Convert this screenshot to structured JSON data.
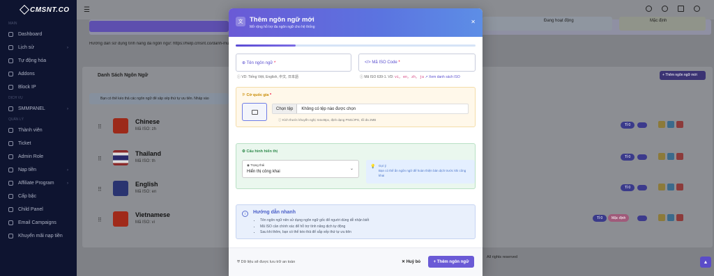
{
  "brand": {
    "logo_text": "CMSNT.CO"
  },
  "sidebar": {
    "sections": {
      "main": "MAIN",
      "services": "DỊCH VỤ",
      "admin": "QUẢN LÝ"
    },
    "items": [
      {
        "label": "Dashboard"
      },
      {
        "label": "Lịch sử"
      },
      {
        "label": "Tự động hóa"
      },
      {
        "label": "Addons"
      },
      {
        "label": "Block IP"
      },
      {
        "label": "SMMPANEL"
      },
      {
        "label": "Thành viên"
      },
      {
        "label": "Ticket"
      },
      {
        "label": "Admin Role"
      },
      {
        "label": "Nạp tiền"
      },
      {
        "label": "Affiliate Program"
      },
      {
        "label": "Cấp bậc"
      },
      {
        "label": "Child Panel"
      },
      {
        "label": "Email Campaigns"
      },
      {
        "label": "Khuyến mãi nạp tiền"
      }
    ]
  },
  "background": {
    "stats_labels": [
      "Đang hoạt động",
      "Mặc định"
    ],
    "guide_text": "Hướng dẫn sử dụng tính năng đa ngôn ngữ: https://help.cmsnt.co/danh-mu",
    "list_title": "Danh Sách Ngôn Ngữ",
    "add_button": "+ Thêm ngôn ngữ mới",
    "info_text": "Bạn có thể kéo thả các ngôn ngữ để sắp xếp thứ tự ưu tiên. Nhấp vào",
    "languages": [
      {
        "name": "Chinese",
        "iso": "Mã ISO: zh",
        "count": "Tỉ 0"
      },
      {
        "name": "Thailand",
        "iso": "Mã ISO: th",
        "count": "Tỉ 0"
      },
      {
        "name": "English",
        "iso": "Mã ISO: en",
        "count": "Tỉ 0"
      },
      {
        "name": "Vietnamese",
        "iso": "Mã ISO: vi",
        "count": "Tỉ 0",
        "default_badge": "Mặc định"
      }
    ],
    "footer_text": "All rights reserved"
  },
  "modal": {
    "title": "Thêm ngôn ngữ mới",
    "subtitle": "Mở rộng hỗ trợ đa ngôn ngữ cho hệ thống",
    "progress_fraction": 0.25,
    "name_field": {
      "label": "Tên ngôn ngữ",
      "hint": "VD: Tiếng Việt, English, 中文, 日本語"
    },
    "iso_field": {
      "label": "Mã ISO Code",
      "hint_prefix": "Mã ISO 639-1. VD:",
      "hint_codes": "vi, en, zh, ja",
      "hint_link": "Xem danh sách ISO"
    },
    "flag_section": {
      "title": "Cờ quốc gia",
      "file_button": "Chọn tệp",
      "file_name": "Không có tệp nào được chọn",
      "hint": "Kích thước khuyến nghị: 64x48px, định dạng PNG/JPG, tối đa 2MB"
    },
    "display_section": {
      "title": "Cấu hình hiển thị",
      "status_label": "Trạng thái",
      "status_value": "Hiển thị công khai",
      "tip_title": "Gợi ý",
      "tip_body": "Bạn có thể ẩn ngôn ngữ để hoàn thiện bản dịch trước khi công khai"
    },
    "quick_guide": {
      "title": "Hướng dẫn nhanh",
      "items": [
        "Tên ngôn ngữ nên sử dụng ngôn ngữ gốc để người dùng dễ nhận biết",
        "Mã ISO cần chính xác để hỗ trợ tính năng dịch tự động",
        "Sau khi thêm, bạn có thể kéo thả để sắp xếp thứ tự ưu tiên"
      ]
    },
    "footer": {
      "note": "Dữ liệu sẽ được lưu trữ an toàn",
      "cancel": "Huỷ bỏ",
      "submit": "Thêm ngôn ngữ"
    }
  },
  "colors": {
    "accent": "#6a5ad6",
    "sidebar_bg": "#0e1430"
  }
}
